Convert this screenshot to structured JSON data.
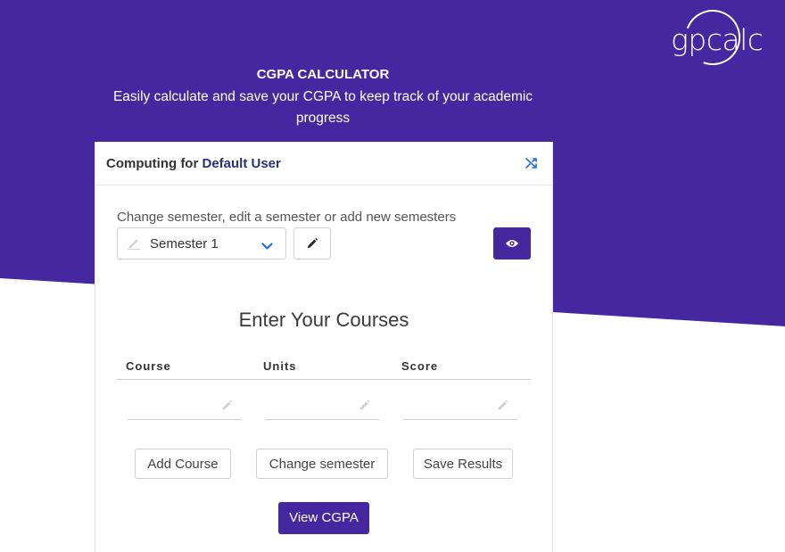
{
  "brand": {
    "logo_text": "gpcalc"
  },
  "hero": {
    "title": "CGPA CALCULATOR",
    "subtitle": "Easily calculate and save your CGPA to keep track of your academic progress"
  },
  "card": {
    "computing_prefix": "Computing for",
    "user_name": "Default User",
    "semester_hint": "Change semester, edit a semester or add new semesters",
    "semester_selected": "Semester 1",
    "section_title": "Enter Your Courses",
    "columns": [
      "Course",
      "Units",
      "Score"
    ],
    "row": {
      "course_value": "",
      "units_value": "",
      "score_value": ""
    },
    "buttons": {
      "add_course": "Add Course",
      "change_semester": "Change semester",
      "save_results": "Save Results",
      "view_cgpa": "View CGPA"
    }
  },
  "colors": {
    "brand_purple": "#4527a0",
    "user_name_navy": "#2b2f7a",
    "chevron_blue": "#1e6fd9"
  },
  "icons": [
    "shuffle-icon",
    "pencil-icon",
    "chevron-down-icon",
    "eye-icon"
  ]
}
